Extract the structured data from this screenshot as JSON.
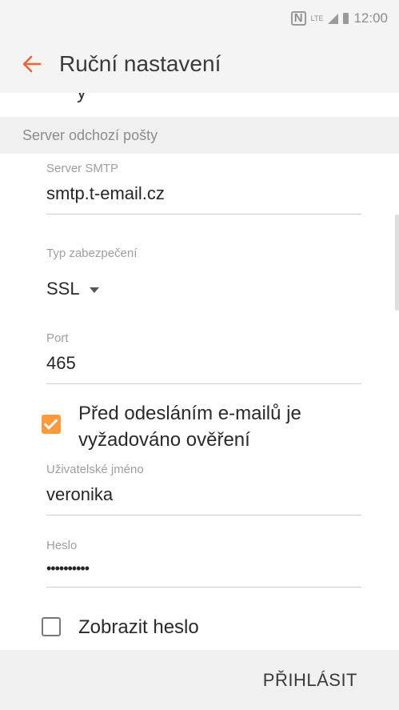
{
  "status_bar": {
    "nfc_icon": "nfc-icon",
    "lte_label": "LTE",
    "signal_icon": "signal-icon",
    "battery_icon": "battery-icon",
    "time": "12:00"
  },
  "app_bar": {
    "back_icon": "arrow-left-icon",
    "back_color": "#f2613a",
    "title": "Ruční nastavení"
  },
  "clipped_previous_text": "y",
  "section": {
    "title": "Server odchozí pošty"
  },
  "fields": {
    "smtp_server": {
      "label": "Server SMTP",
      "value": "smtp.t-email.cz"
    },
    "security_type": {
      "label": "Typ zabezpečení",
      "value": "SSL"
    },
    "port": {
      "label": "Port",
      "value": "465"
    },
    "username": {
      "label": "Uživatelské jméno",
      "value": "veronika"
    },
    "password": {
      "label": "Heslo",
      "value": "••••••••••"
    }
  },
  "checkboxes": {
    "require_auth": {
      "label_line1": "Před odesláním e-mailů je",
      "label_line2": "vyžadováno ověření",
      "checked": true,
      "color": "#ff9a3c"
    },
    "show_password": {
      "label": "Zobrazit heslo",
      "checked": false
    }
  },
  "bottom_bar": {
    "login_label": "PŘIHLÁSIT"
  }
}
